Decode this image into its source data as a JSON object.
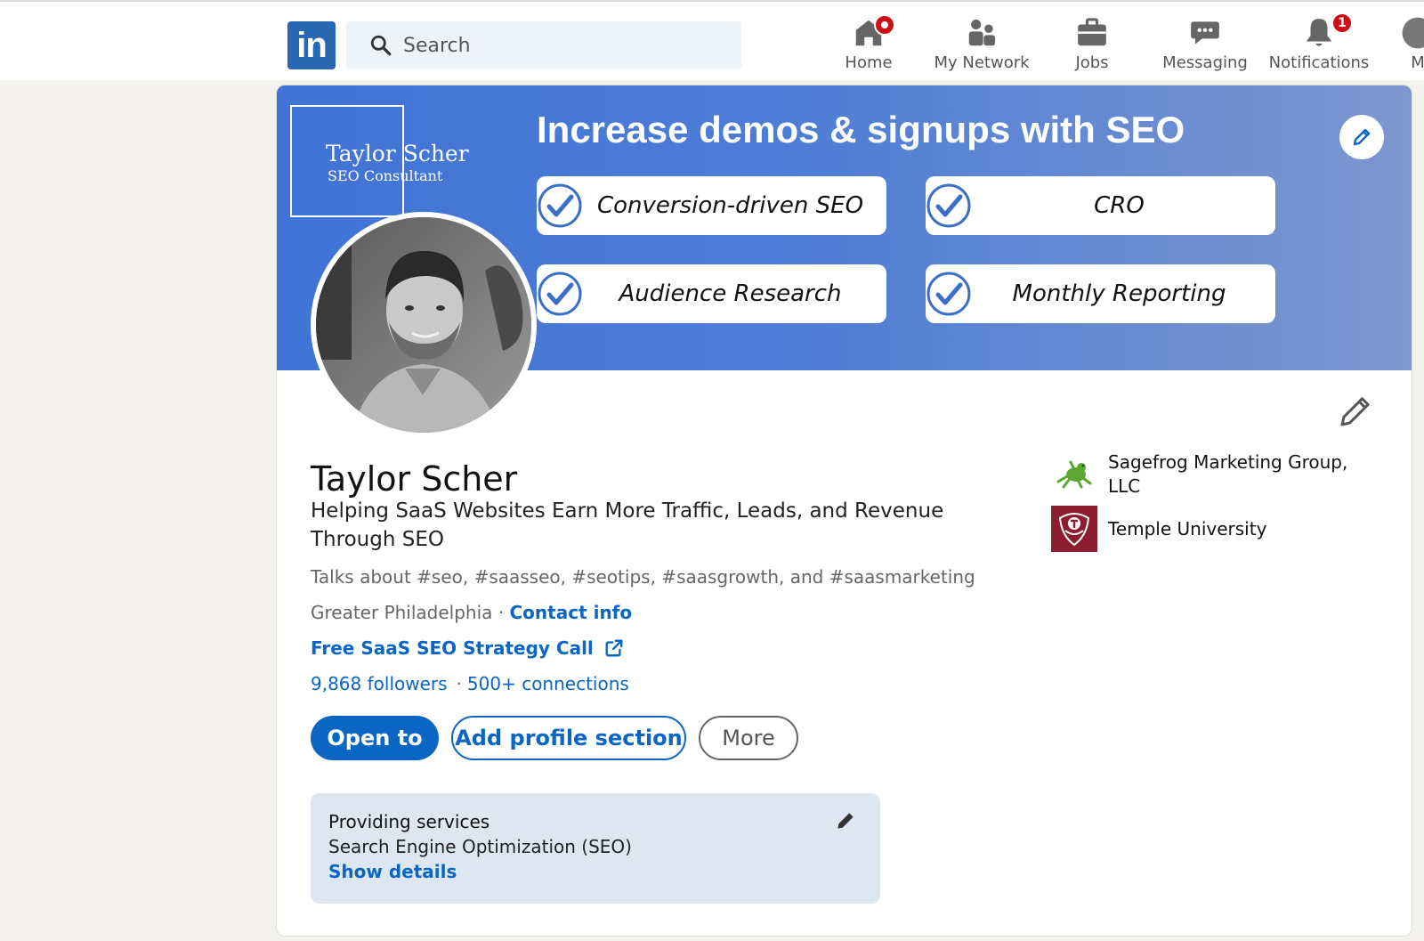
{
  "nav": {
    "logo_text": "in",
    "search_placeholder": "Search",
    "items": [
      {
        "label": "Home",
        "icon": "home-icon"
      },
      {
        "label": "My Network",
        "icon": "network-icon"
      },
      {
        "label": "Jobs",
        "icon": "briefcase-icon"
      },
      {
        "label": "Messaging",
        "icon": "chat-icon"
      },
      {
        "label": "Notifications",
        "icon": "bell-icon",
        "badge": "1"
      },
      {
        "label": "M",
        "icon": "avatar-icon"
      }
    ]
  },
  "banner": {
    "brand_name": "Taylor Scher",
    "brand_sub": "SEO Consultant",
    "title": "Increase demos & signups with SEO",
    "pills": [
      "Conversion-driven SEO",
      "CRO",
      "Audience Research",
      "Monthly Reporting"
    ]
  },
  "profile": {
    "name": "Taylor Scher",
    "headline": "Helping SaaS Websites Earn More Traffic, Leads, and Revenue Through SEO",
    "talks": "Talks about #seo, #saasseo, #seotips, #saasgrowth, and #saasmarketing",
    "location": "Greater Philadelphia",
    "location_sep": " · ",
    "contact_info": "Contact info",
    "external_link": "Free SaaS SEO Strategy Call",
    "followers": "9,868 followers",
    "stats_sep": "·",
    "connections": "500+ connections"
  },
  "buttons": {
    "open_to": "Open to",
    "add_section": "Add profile section",
    "more": "More"
  },
  "services": {
    "title": "Providing services",
    "subtitle": "Search Engine Optimization (SEO)",
    "details": "Show details"
  },
  "orgs": [
    {
      "name": "Sagefrog Marketing Group, LLC",
      "icon": "frog-logo-icon"
    },
    {
      "name": "Temple University",
      "icon": "temple-logo-icon"
    }
  ],
  "colors": {
    "accent": "#0a66c2",
    "badge": "#cc1016",
    "banner": "#3f73d6"
  }
}
